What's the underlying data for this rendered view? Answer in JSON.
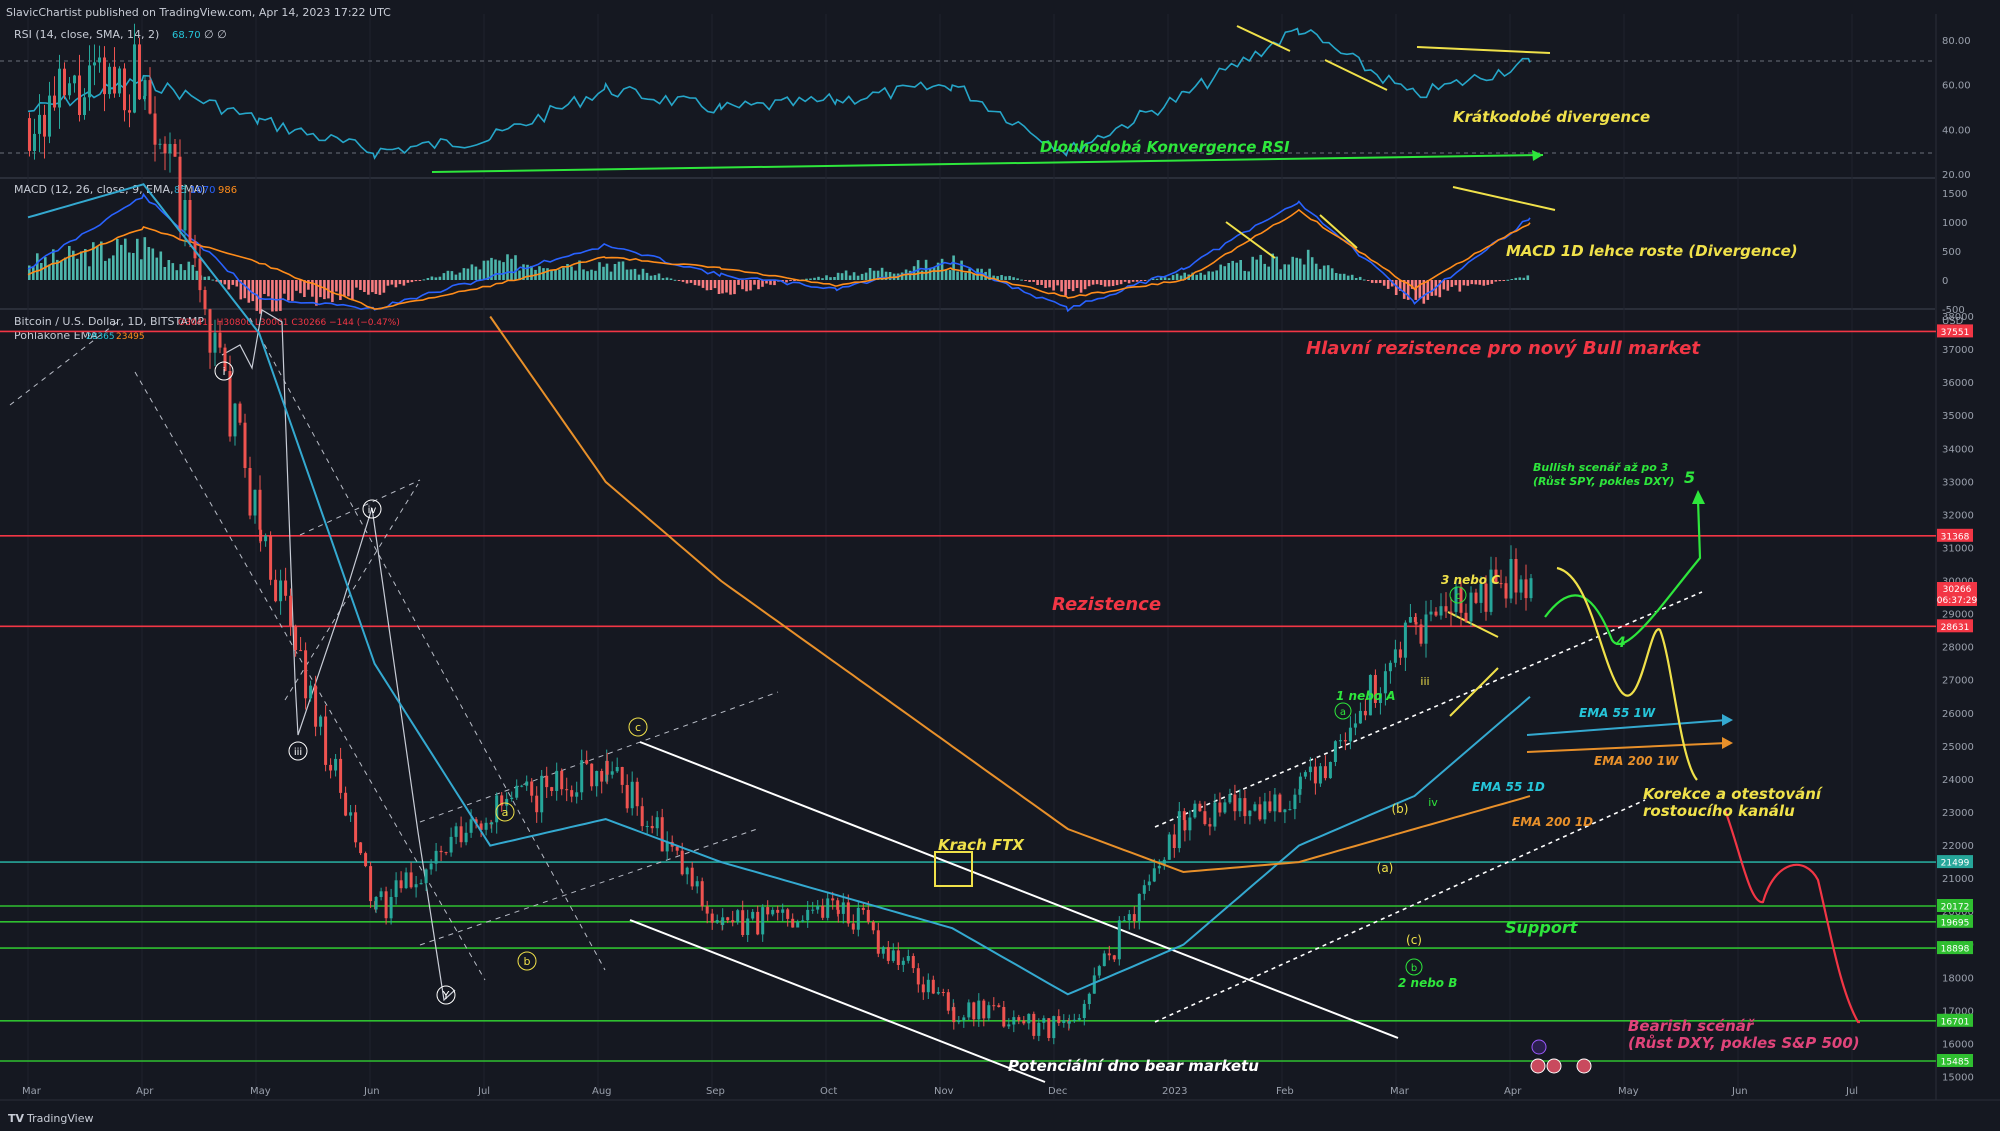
{
  "header": {
    "published": "SlavicChartist published on TradingView.com, Apr 14, 2023 17:22 UTC",
    "footer_brand": "TradingView"
  },
  "rsi": {
    "legend": "RSI (14, close, SMA, 14, 2)",
    "value": "68.70",
    "value_color": "#26c6da",
    "extra": "∅ ∅",
    "ticks": [
      "80.00",
      "60.00",
      "40.00",
      "20.00"
    ],
    "annotations": {
      "long_convergence": "Dlouhodobá Konvergence RSI",
      "short_divergence": "Krátkodobé divergence"
    }
  },
  "macd": {
    "legend": "MACD (12, 26, close, 9, EMA, EMA)",
    "values": [
      "85",
      "1070",
      "986"
    ],
    "ticks": [
      "1500",
      "1000",
      "500",
      "0",
      "-500"
    ],
    "annotation": "MACD 1D lehce roste (Divergence)"
  },
  "price": {
    "legend_line1": "Bitcoin / U.S. Dollar, 1D, BITSTAMP",
    "legend_ohlc": "O30411 H30800 L30001 C30266 −144 (−0.47%)",
    "legend_line2": "Pohlakone EMA",
    "ema_values": [
      "28365",
      "23495"
    ],
    "currency": "USD",
    "ticks": [
      "38000",
      "37000",
      "36000",
      "35000",
      "34000",
      "33000",
      "32000",
      "31000",
      "30000",
      "29000",
      "28000",
      "27000",
      "26000",
      "25000",
      "24000",
      "23000",
      "22000",
      "21000",
      "20000",
      "19000",
      "18000",
      "17000",
      "16000",
      "15000"
    ],
    "levels": [
      {
        "label": "37551",
        "color": "#f23645"
      },
      {
        "label": "31368",
        "color": "#f23645"
      },
      {
        "label": "28631",
        "color": "#f23645"
      },
      {
        "label": "21499",
        "color": "#26a69a"
      },
      {
        "label": "20172",
        "color": "#2fbf30"
      },
      {
        "label": "19695",
        "color": "#2fbf30"
      },
      {
        "label": "18898",
        "color": "#2fbf30"
      },
      {
        "label": "16701",
        "color": "#2fbf30"
      },
      {
        "label": "15485",
        "color": "#2fbf30"
      }
    ],
    "current": {
      "label": "30266",
      "countdown": "06:37:29",
      "color": "#f23645"
    },
    "annotations": {
      "main_resistance": "Hlavní rezistence pro nový Bull market",
      "resistance": "Rezistence",
      "support": "Support",
      "ftx": "Krach FTX",
      "bear_bottom": "Potenciální dno bear marketu",
      "bull_line1": "Bullish scenář až po 3",
      "bull_line2": "(Růst SPY, pokles DXY)",
      "bull_wave": "5",
      "wave4": "4",
      "three_or_c": "3 nebo C",
      "one_or_a": "1 nebo A",
      "two_or_b": "2 nebo B",
      "ema55w": "EMA 55 1W",
      "ema200w": "EMA 200 1W",
      "ema55d": "EMA 55 1D",
      "ema200d": "EMA 200 1D",
      "correction1": "Korekce a otestování",
      "correction2": "rostoucího kanálu",
      "bear_line1": "Bearish scénář",
      "bear_line2": "(Růst DXY, pokles S&P 500)"
    },
    "wave_labels": [
      "i",
      "iii",
      "iv",
      "Y",
      "a",
      "b",
      "c",
      "(a)",
      "(b)",
      "(c)",
      "iii",
      "iv",
      "a",
      "c",
      "b"
    ]
  },
  "time_axis": [
    "Mar",
    "Apr",
    "May",
    "Jun",
    "Jul",
    "Aug",
    "Sep",
    "Oct",
    "Nov",
    "Dec",
    "2023",
    "Feb",
    "Mar",
    "Apr",
    "May",
    "Jun",
    "Jul"
  ],
  "chart_data": [
    {
      "type": "line",
      "title": "RSI (14, close, SMA, 14, 2)",
      "x": [
        "Mar",
        "Apr",
        "May",
        "Jun",
        "Jul",
        "Aug",
        "Sep",
        "Oct",
        "Nov",
        "Dec",
        "2023",
        "Feb",
        "Mar",
        "Apr"
      ],
      "series": [
        {
          "name": "RSI",
          "values": [
            48,
            62,
            44,
            30,
            36,
            58,
            49,
            53,
            60,
            30,
            55,
            85,
            55,
            70
          ]
        }
      ],
      "ylim": [
        20,
        80
      ]
    },
    {
      "type": "bar",
      "title": "MACD (12, 26, close, 9, EMA, EMA)",
      "x": [
        "Mar",
        "Apr",
        "May",
        "Jun",
        "Jul",
        "Aug",
        "Sep",
        "Oct",
        "Nov",
        "Dec",
        "2023",
        "Feb",
        "Mar",
        "Apr"
      ],
      "series": [
        {
          "name": "MACD",
          "values": [
            200,
            1450,
            -300,
            -500,
            50,
            600,
            80,
            -150,
            300,
            -500,
            200,
            1350,
            -380,
            1070
          ]
        },
        {
          "name": "Signal",
          "values": [
            100,
            900,
            300,
            -500,
            -100,
            400,
            200,
            -100,
            200,
            -300,
            0,
            1200,
            -150,
            986
          ]
        },
        {
          "name": "Histogram",
          "values": [
            300,
            600,
            -400,
            -200,
            300,
            300,
            -200,
            100,
            300,
            -200,
            100,
            400,
            -300,
            85
          ]
        }
      ],
      "ylim": [
        -500,
        1500
      ]
    },
    {
      "type": "line",
      "title": "Bitcoin / U.S. Dollar, 1D, BITSTAMP",
      "ylabel": "USD",
      "x": [
        "2022-03",
        "2022-04",
        "2022-05",
        "2022-06",
        "2022-07",
        "2022-08",
        "2022-09",
        "2022-10",
        "2022-11",
        "2022-12",
        "2023-01",
        "2023-02",
        "2023-03",
        "2023-04"
      ],
      "series": [
        {
          "name": "BTCUSD",
          "values": [
            44000,
            45500,
            31500,
            20000,
            23000,
            24500,
            19500,
            20300,
            17000,
            16500,
            23000,
            23500,
            28500,
            30266
          ]
        },
        {
          "name": "EMA 55 1D",
          "values": [
            41000,
            42000,
            37500,
            27500,
            22000,
            22800,
            21500,
            20500,
            19500,
            17500,
            19000,
            22000,
            23500,
            26500
          ]
        },
        {
          "name": "EMA 200 1D",
          "values": [
            null,
            null,
            null,
            null,
            38000,
            33000,
            30000,
            27500,
            25000,
            22500,
            21200,
            21500,
            22500,
            23495
          ]
        }
      ],
      "levels": [
        37551,
        31368,
        28631,
        21499,
        20172,
        19695,
        18898,
        16701,
        15485
      ],
      "ylim": [
        15000,
        38500
      ]
    }
  ]
}
